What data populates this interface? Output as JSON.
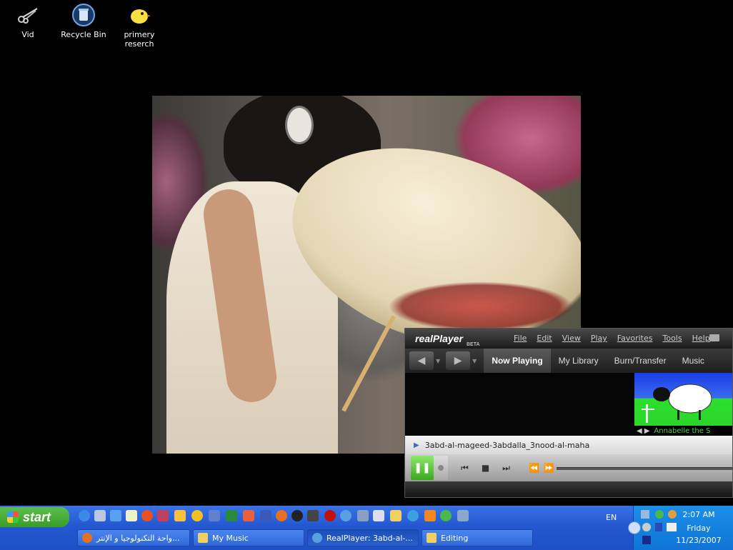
{
  "desktop": {
    "icons": [
      {
        "label": "Vid",
        "icon": "scissors-icon"
      },
      {
        "label": "Recycle Bin",
        "icon": "recycle-bin-icon"
      },
      {
        "label": "primery reserch",
        "icon": "chick-icon"
      }
    ]
  },
  "realplayer": {
    "logo": "realPlayer",
    "beta": "BETA",
    "menu": [
      "File",
      "Edit",
      "View",
      "Play",
      "Favorites",
      "Tools",
      "Help"
    ],
    "tabs": [
      "Now Playing",
      "My Library",
      "Burn/Transfer",
      "Music"
    ],
    "active_tab": "Now Playing",
    "ad_caption": "Annabelle the S",
    "track": "3abd-al-mageed-3abdalla_3nood-al-maha"
  },
  "taskbar": {
    "start_label": "start",
    "language": "EN",
    "clock_time": "2:07 AM",
    "clock_day": "Friday",
    "clock_date": "11/23/2007",
    "buttons": [
      {
        "label": "واحة التكنولوجيا و الإنتر...",
        "icon": "firefox-icon"
      },
      {
        "label": "My Music",
        "icon": "folder-music-icon"
      },
      {
        "label": "RealPlayer: 3abd-al-...",
        "icon": "realplayer-icon"
      },
      {
        "label": "Editing",
        "icon": "folder-icon"
      }
    ]
  },
  "colors": {
    "taskbar_blue": "#2458d0",
    "start_green": "#399c2a",
    "tray_blue": "#0f74d6",
    "rp_play_green": "#3aa81c"
  }
}
